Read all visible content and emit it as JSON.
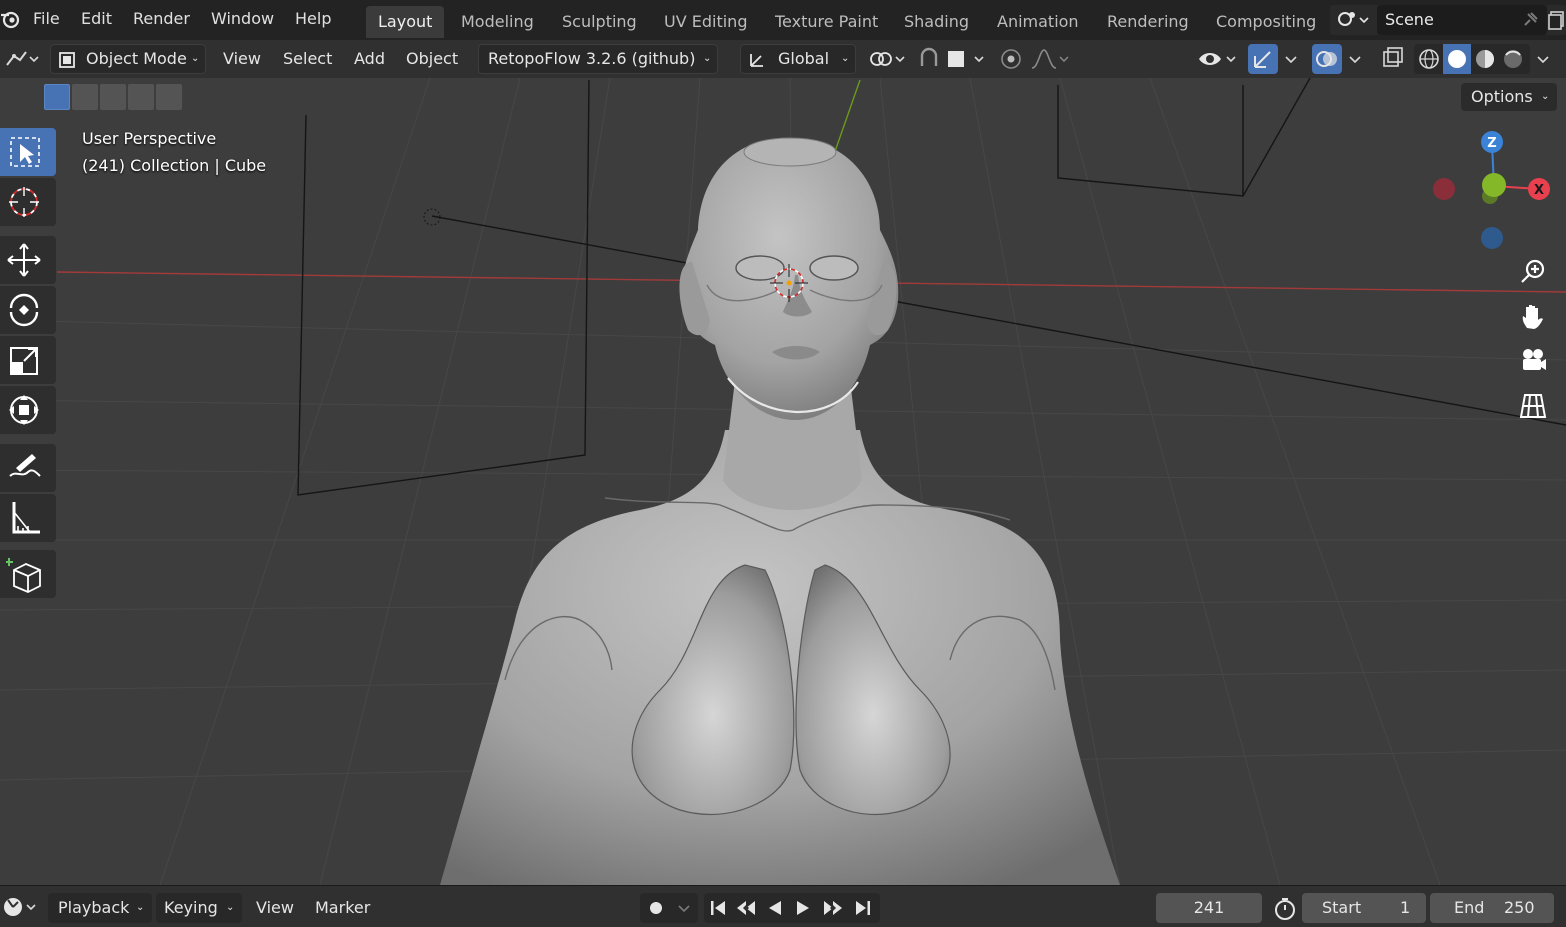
{
  "menubar": {
    "items": [
      "File",
      "Edit",
      "Render",
      "Window",
      "Help"
    ]
  },
  "workspaces": [
    "Layout",
    "Modeling",
    "Sculpting",
    "UV Editing",
    "Texture Paint",
    "Shading",
    "Animation",
    "Rendering",
    "Compositing"
  ],
  "active_workspace": "Layout",
  "scene": {
    "name": "Scene"
  },
  "header": {
    "mode": "Object Mode",
    "menus": [
      "View",
      "Select",
      "Add",
      "Object"
    ],
    "addon": "RetopoFlow 3.2.6 (github)",
    "orientation": "Global"
  },
  "viewport": {
    "view_name": "User Perspective",
    "context": "(241) Collection | Cube",
    "options_label": "Options",
    "gizmo": {
      "z": "Z",
      "x": "X"
    }
  },
  "timeline": {
    "menus": [
      "Playback",
      "Keying",
      "View",
      "Marker"
    ],
    "current_frame": "241",
    "start_label": "Start",
    "start_value": "1",
    "end_label": "End",
    "end_value": "250"
  },
  "colors": {
    "accent": "#4772b3",
    "x_axis": "#e8404f",
    "y_axis": "#84b828",
    "z_axis": "#3a83d6"
  },
  "icons": {
    "tools": [
      "select-box-icon",
      "cursor-icon",
      "move-icon",
      "rotate-icon",
      "scale-icon",
      "transform-icon",
      "annotate-icon",
      "measure-icon",
      "add-cube-icon"
    ],
    "nav": [
      "zoom-icon",
      "pan-hand-icon",
      "camera-icon",
      "grid-icon"
    ]
  }
}
